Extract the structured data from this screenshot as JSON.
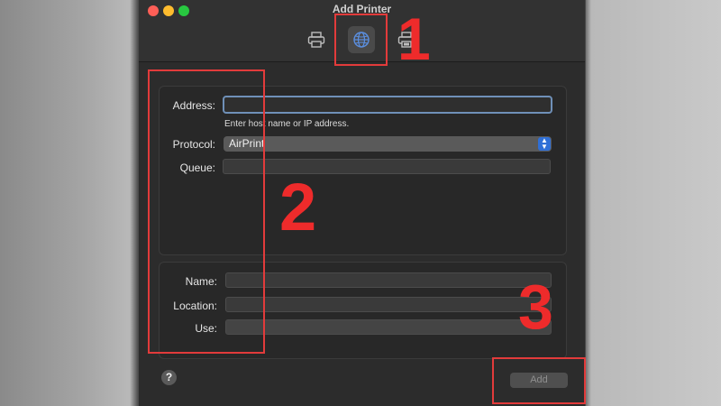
{
  "window": {
    "title": "Add Printer"
  },
  "toolbar": {
    "tabs": [
      {
        "icon": "printer-icon",
        "selected": false
      },
      {
        "icon": "globe-icon",
        "selected": true
      },
      {
        "icon": "printer-windows-icon",
        "selected": false
      }
    ]
  },
  "form": {
    "address_label": "Address:",
    "address_value": "",
    "address_hint": "Enter host name or IP address.",
    "protocol_label": "Protocol:",
    "protocol_value": "AirPrint",
    "queue_label": "Queue:",
    "queue_value": "",
    "name_label": "Name:",
    "name_value": "",
    "location_label": "Location:",
    "location_value": "",
    "use_label": "Use:",
    "use_value": ""
  },
  "footer": {
    "help_label": "?",
    "add_label": "Add"
  },
  "annotations": {
    "n1": "1",
    "n2": "2",
    "n3": "3",
    "color": "#e23b3b"
  }
}
